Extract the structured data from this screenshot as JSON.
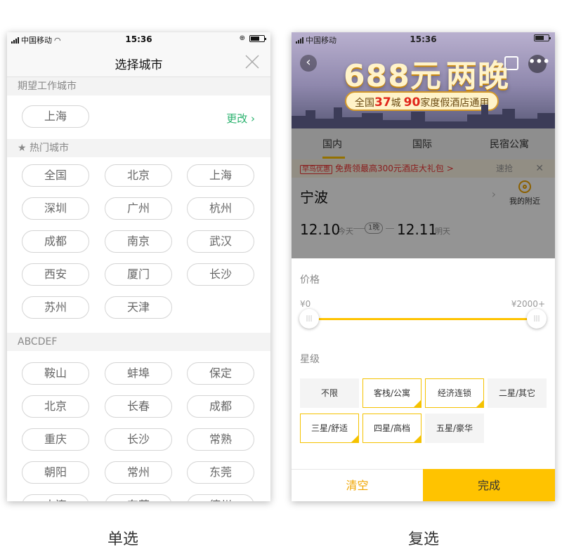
{
  "left": {
    "status": {
      "carrier": "中国移动",
      "time": "15:36"
    },
    "nav": {
      "title": "选择城市"
    },
    "expect_section": {
      "label": "期望工作城市",
      "city": "上海",
      "change_label": "更改 ›"
    },
    "hot_section": {
      "label": "★ 热门城市",
      "cities": [
        "全国",
        "北京",
        "上海",
        "深圳",
        "广州",
        "杭州",
        "成都",
        "南京",
        "武汉",
        "西安",
        "厦门",
        "长沙",
        "苏州",
        "天津"
      ]
    },
    "abc_section": {
      "label": "ABCDEF",
      "cities": [
        "鞍山",
        "蚌埠",
        "保定",
        "北京",
        "长春",
        "成都",
        "重庆",
        "长沙",
        "常熟",
        "朝阳",
        "常州",
        "东莞",
        "大连",
        "东营",
        "德州"
      ]
    },
    "caption": "单选"
  },
  "right": {
    "status": {
      "carrier": "中国移动",
      "time": "15:36"
    },
    "banner": {
      "headline": "688元",
      "headline_sub": "两晚",
      "pill_prefix": "全国",
      "pill_num1": "37",
      "pill_mid": "城",
      "pill_num2": "90",
      "pill_suffix": "家度假酒店通用",
      "more_label": "•••"
    },
    "tabs": [
      "国内",
      "国际",
      "民宿公寓"
    ],
    "coupon": {
      "tag": "早鸟优惠",
      "text": "免费领最高300元酒店大礼包 >",
      "grab": "速抢",
      "close": "✕"
    },
    "destination": {
      "city": "宁波",
      "nearby_label": "我的附近"
    },
    "dates": {
      "checkin": "12.10",
      "checkin_sub": "今天",
      "nights": "1晚",
      "checkout": "12.11",
      "checkout_sub": "明天"
    },
    "filter": {
      "price_label": "价格",
      "price_min": "¥0",
      "price_max": "¥2000+",
      "star_label": "星级",
      "stars": [
        {
          "label": "不限",
          "selected": false
        },
        {
          "label": "客栈/公寓",
          "selected": true
        },
        {
          "label": "经济连锁",
          "selected": true
        },
        {
          "label": "二星/其它",
          "selected": false
        },
        {
          "label": "三星/舒适",
          "selected": true
        },
        {
          "label": "四星/高档",
          "selected": true
        },
        {
          "label": "五星/豪华",
          "selected": false
        }
      ],
      "clear_label": "清空",
      "done_label": "完成"
    },
    "caption": "复选"
  },
  "colors": {
    "accent": "#ffc300",
    "link_green": "#2ab26e",
    "selected_border": "#f5c200"
  }
}
